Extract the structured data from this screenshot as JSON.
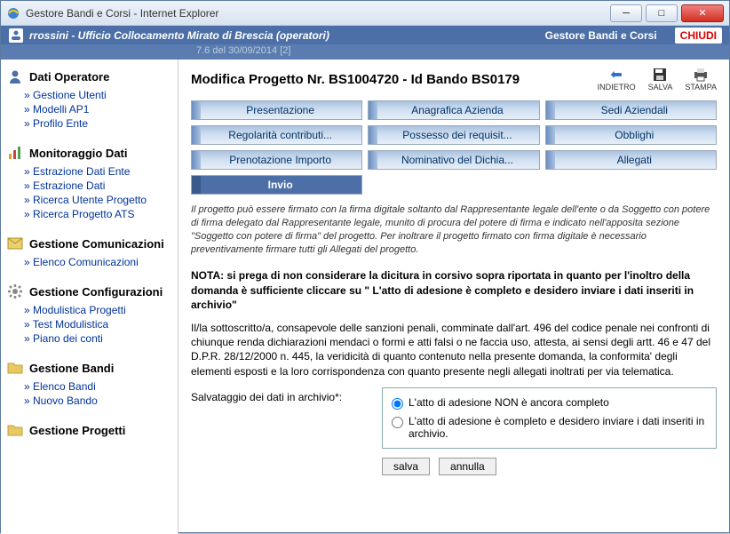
{
  "window": {
    "title": "Gestore Bandi e Corsi - Internet Explorer"
  },
  "header": {
    "user_context": "rrossini - Ufficio Collocamento Mirato di Brescia (operatori)",
    "app_title": "Gestore Bandi e Corsi",
    "close_label": "CHIUDI",
    "version": "7.6 del 30/09/2014 [2]"
  },
  "sidebar": [
    {
      "title": "Dati Operatore",
      "icon": "user-icon",
      "items": [
        "Gestione Utenti",
        "Modelli AP1",
        "Profilo Ente"
      ]
    },
    {
      "title": "Monitoraggio Dati",
      "icon": "chart-icon",
      "items": [
        "Estrazione Dati Ente",
        "Estrazione Dati",
        "Ricerca Utente Progetto",
        "Ricerca Progetto ATS"
      ]
    },
    {
      "title": "Gestione Comunicazioni",
      "icon": "mail-icon",
      "items": [
        "Elenco Comunicazioni"
      ]
    },
    {
      "title": "Gestione Configurazioni",
      "icon": "gear-icon",
      "items": [
        "Modulistica Progetti",
        "Test Modulistica",
        "Piano dei conti"
      ]
    },
    {
      "title": "Gestione Bandi",
      "icon": "folder-icon",
      "items": [
        "Elenco Bandi",
        "Nuovo Bando"
      ]
    },
    {
      "title": "Gestione Progetti",
      "icon": "folder-icon",
      "items": []
    }
  ],
  "page": {
    "title": "Modifica Progetto Nr. BS1004720 - Id Bando BS0179",
    "actions": {
      "back": "INDIETRO",
      "save": "SALVA",
      "print": "STAMPA"
    },
    "tabs": [
      "Presentazione",
      "Anagrafica Azienda",
      "Sedi Aziendali",
      "Regolarità contributi...",
      "Possesso dei requisit...",
      "Obblighi",
      "Prenotazione Importo",
      "Nominativo del Dichia...",
      "Allegati",
      "Invio"
    ],
    "active_tab_index": 9,
    "italic_note": "Il progetto può essere firmato con la firma digitale soltanto dal Rappresentante legale dell'ente o da Soggetto con potere di firma delegato dal Rappresentante legale, munito di procura del potere di firma e indicato nell'apposita sezione \"Soggetto con potere di firma\" del progetto. Per inoltrare il progetto firmato con firma digitale è necessario preventivamente firmare tutti gli Allegati del progetto.",
    "bold_note": "NOTA: si prega di non considerare la dicitura in corsivo sopra riportata in quanto per l'inoltro della domanda è sufficiente cliccare su \" L'atto di adesione è completo e desidero inviare i dati inseriti in archivio\"",
    "declaration": "Il/la sottoscritto/a, consapevole delle sanzioni penali, comminate dall'art. 496 del codice penale nei confronti di chiunque renda dichiarazioni mendaci o formi e atti falsi o ne faccia uso, attesta, ai sensi degli artt. 46 e 47 del D.P.R. 28/12/2000 n. 445, la veridicità di quanto contenuto nella presente domanda, la conformita' degli elementi esposti e la loro corrispondenza con quanto presente negli allegati inoltrati per via telematica.",
    "save_label": "Salvataggio dei dati in archivio*:",
    "radio": {
      "incomplete": "L'atto di adesione NON è ancora completo",
      "complete": "L'atto di adesione è completo e desidero inviare i dati inseriti in archivio.",
      "selected": "incomplete"
    },
    "buttons": {
      "save": "salva",
      "cancel": "annulla"
    }
  }
}
